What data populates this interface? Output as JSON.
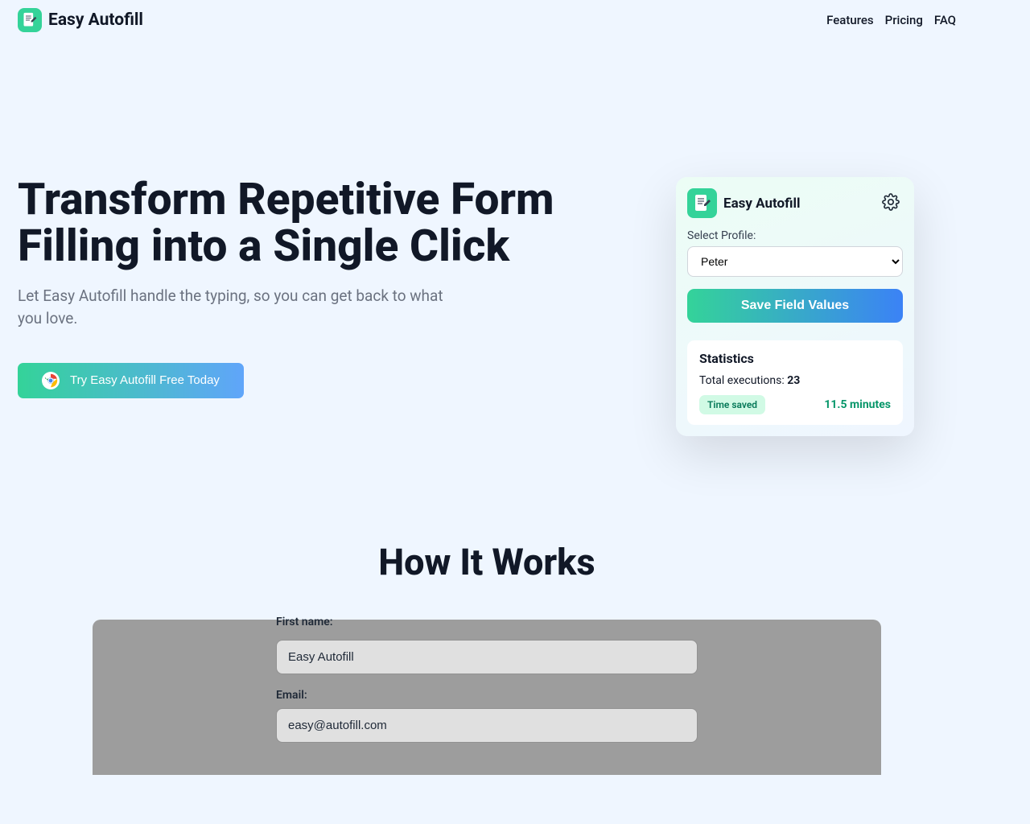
{
  "header": {
    "brand": "Easy Autofill",
    "nav": {
      "features": "Features",
      "pricing": "Pricing",
      "faq": "FAQ"
    }
  },
  "hero": {
    "title": "Transform Repetitive Form Filling into a Single Click",
    "subtitle": "Let Easy Autofill handle the typing, so you can get back to what you love.",
    "cta": "Try Easy Autofill Free Today"
  },
  "card": {
    "brand": "Easy Autofill",
    "select_label": "Select Profile:",
    "profile_value": "Peter",
    "save_label": "Save Field Values",
    "stats_title": "Statistics",
    "exec_label": "Total executions: ",
    "exec_value": "23",
    "time_pill": "Time saved",
    "time_value": "11.5 minutes"
  },
  "hiw": {
    "title": "How It Works",
    "first_name_label": "First name:",
    "first_name_value": "Easy Autofill",
    "email_label": "Email:",
    "email_value": "easy@autofill.com"
  }
}
